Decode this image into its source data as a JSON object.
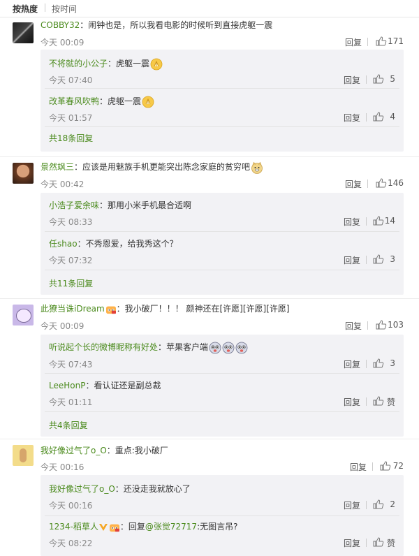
{
  "sort": {
    "hot": "按热度",
    "time": "按时间"
  },
  "labels": {
    "reply": "回复"
  },
  "comments": [
    {
      "user": "COBBY32",
      "text": "：闹钟也是，所以我看电影的时候听到直接虎躯一震",
      "time": "今天 00:09",
      "likes": "171",
      "replies": [
        {
          "user": "不将就的小公子",
          "text": "：虎躯一震",
          "time": "今天 07:40",
          "likes": "5"
        },
        {
          "user": "改革春风吹鸭",
          "text": "：虎躯一震",
          "time": "今天 01:57",
          "likes": "4"
        }
      ],
      "more": "共18条回复"
    },
    {
      "user": "景然飒三",
      "text": "：应该是用魅族手机更能突出陈念家庭的贫穷吧",
      "time": "今天 00:42",
      "likes": "146",
      "replies": [
        {
          "user": "小浩子爱余味",
          "text": "：那用小米手机最合适啊",
          "time": "今天 08:33",
          "likes": "14"
        },
        {
          "user": "任shao",
          "text": "：不秀恩爱，给我秀这个？",
          "time": "今天 07:32",
          "likes": "3"
        }
      ],
      "more": "共11条回复"
    },
    {
      "user": "此獠当诛iDream",
      "text": "：我小破厂！！！ 颜神还在[许愿][许愿][许愿]",
      "time": "今天 00:09",
      "likes": "103",
      "replies": [
        {
          "user": "听说起个长的微博昵称有好处",
          "text": "：苹果客户端",
          "time": "今天 07:43",
          "likes": "3"
        },
        {
          "user": "LeeHonP",
          "text": "：看认证还是副总裁",
          "time": "今天 01:11",
          "likes": "赞"
        }
      ],
      "more": "共4条回复"
    },
    {
      "user": "我好像过气了o_O",
      "text": "：重点:我小破厂",
      "time": "今天 00:16",
      "likes": "72",
      "replies": [
        {
          "user": "我好像过气了o_O",
          "text": "：还没走我就放心了",
          "time": "今天 00:16",
          "likes": "2"
        },
        {
          "user": "1234-稻草人",
          "text_prefix": "：回复",
          "mention": "@张觉72717",
          "text": ":无图言吊?",
          "time": "今天 08:22",
          "likes": "赞"
        }
      ]
    }
  ],
  "colors": {
    "username": "#4a8a1c",
    "meta": "#888888",
    "sub_bg": "#f2f2f5"
  }
}
